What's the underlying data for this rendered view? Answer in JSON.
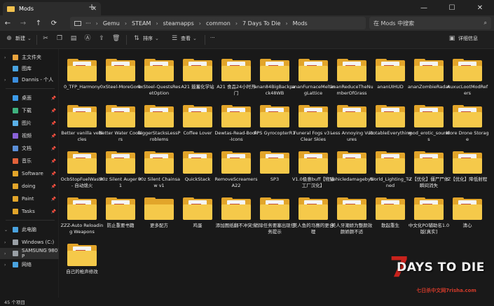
{
  "window": {
    "tab_title": "Mods",
    "new_tab": "+",
    "minimize": "—",
    "maximize": "☐",
    "close": "✕"
  },
  "nav": {
    "back": "←",
    "forward": "→",
    "up": "↑",
    "refresh": "⟳",
    "more": "···"
  },
  "breadcrumb": [
    "Gemu",
    "STEAM",
    "steamapps",
    "common",
    "7 Days To Die",
    "Mods"
  ],
  "search": {
    "placeholder": "在 Mods 中搜索"
  },
  "toolbar": {
    "new_label": "新建",
    "sort_label": "排序",
    "view_label": "查看",
    "more_label": "···",
    "details_label": "详细信息"
  },
  "sidebar": {
    "items": [
      {
        "label": "主文件夹",
        "color": "#e8a33d"
      },
      {
        "label": "图库",
        "color": "#4aa3df"
      },
      {
        "label": "Dannis - 个人",
        "color": "#3b8ede"
      },
      {
        "label": "桌面",
        "color": "#3d9be9"
      },
      {
        "label": "下载",
        "color": "#3fb27f"
      },
      {
        "label": "图片",
        "color": "#5ab0e8"
      },
      {
        "label": "视频",
        "color": "#8a62d8"
      },
      {
        "label": "文档",
        "color": "#5b8fd8"
      },
      {
        "label": "音乐",
        "color": "#e2623a"
      },
      {
        "label": "Software",
        "color": "#e2a52a"
      },
      {
        "label": "doing",
        "color": "#e2a52a"
      },
      {
        "label": "Paint",
        "color": "#e2a52a"
      },
      {
        "label": "Tasks",
        "color": "#e2a52a"
      },
      {
        "label": "此电脑",
        "color": "#4aa3df"
      },
      {
        "label": "Windows (C:)",
        "color": "#9aa0a6"
      },
      {
        "label": "SAMSUNG 980 P",
        "color": "#9aa0a6"
      },
      {
        "label": "网络",
        "color": "#4aa3df"
      }
    ]
  },
  "files": [
    "0_TFP_Harmony",
    "0xSteel-MoreGore",
    "0xSteel-QuestsResetOption",
    "A21 鼓蓄化学站",
    "A21 食品24小时开门",
    "anan84BigBackpack48WB",
    "ananFurnaceMeltingLattice",
    "ananReduceTheNumberOfGrass",
    "ananUIHUD",
    "ananZombieRadar",
    "AuxucLootModRefers",
    "Better vanilla vehicles",
    "Better Water Coolers",
    "BiggerStacksLessProblems",
    "Coffee Lover",
    "Dewtas-Read-Book-Icons",
    "FPS GyrocopterR1",
    "Funeral Fogs v3 - Clear Skies",
    "Less Annoying Vultures",
    "lootableEverything",
    "mod_erotic_sounds",
    "More Drone Storage",
    "OcbStopFuelWaste - 自动熄火",
    "P0z Silent Auger v1",
    "P0z Silent Chainsaw v1",
    "QuickStack",
    "RemoveScreamersA22",
    "SP3",
    "V1.0极意buff【物臻工厂汉化】",
    "vehicledamageby5",
    "World_Lighting_Tuned",
    "Z【优化】僵尸尸体瞬间消失",
    "Z【优化】降低射程",
    "ZZZ-Auto Reloading Weapons",
    "防止重要书籍",
    "更多配方",
    "鸡蛋",
    "添加图纸翻不冲突头",
    "消除任务要塞出现任务提示",
    "美人鱼的马赛的更合理",
    "美人牙潮娇为整颜效颜娇颜不适",
    "散起重生",
    "中文化PO辅助名1.0版[真实]",
    "清心",
    "自己的枪声修改"
  ],
  "status": {
    "count": "45 个项目"
  },
  "watermark": {
    "title": "DAYS TO DIE",
    "seven": "7",
    "site": "七日杀中文网7risha.com"
  }
}
